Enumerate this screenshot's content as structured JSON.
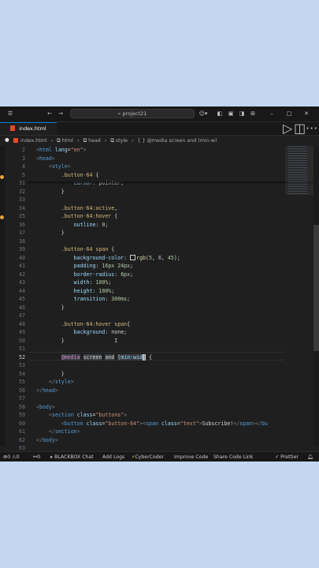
{
  "titlebar": {
    "search_text": "project21",
    "back_icon": "arrow-left-icon",
    "forward_icon": "arrow-right-icon"
  },
  "tab": {
    "filename": "index.html",
    "dirty_marker": "●"
  },
  "breadcrumb": {
    "file": "index.html",
    "items": [
      "html",
      "head",
      "style",
      "{ } @media screen and (min-w)"
    ]
  },
  "editor": {
    "line_numbers": [
      "2",
      "3",
      "4",
      "5",
      "31",
      "32",
      "33",
      "34",
      "35",
      "36",
      "37",
      "38",
      "39",
      "40",
      "41",
      "42",
      "43",
      "44",
      "45",
      "46",
      "47",
      "48",
      "49",
      "50",
      "51",
      "52",
      "53",
      "54",
      "55",
      "56",
      "57",
      "58",
      "59",
      "60",
      "61",
      "62",
      "63"
    ],
    "current_line": "52"
  },
  "status": {
    "problems": "0",
    "warnings": "0",
    "ports": "0",
    "blackbox": "BLACKBOX Chat",
    "add_logs": "Add Logs",
    "cybercoder": "CyberCoder",
    "improve": "Improve Code",
    "share": "Share Code Link",
    "prettier": "Prettier"
  },
  "colors": {
    "accent": "#0078d4",
    "background": "#c3d6f2",
    "editor_bg": "#1f1f1f"
  }
}
